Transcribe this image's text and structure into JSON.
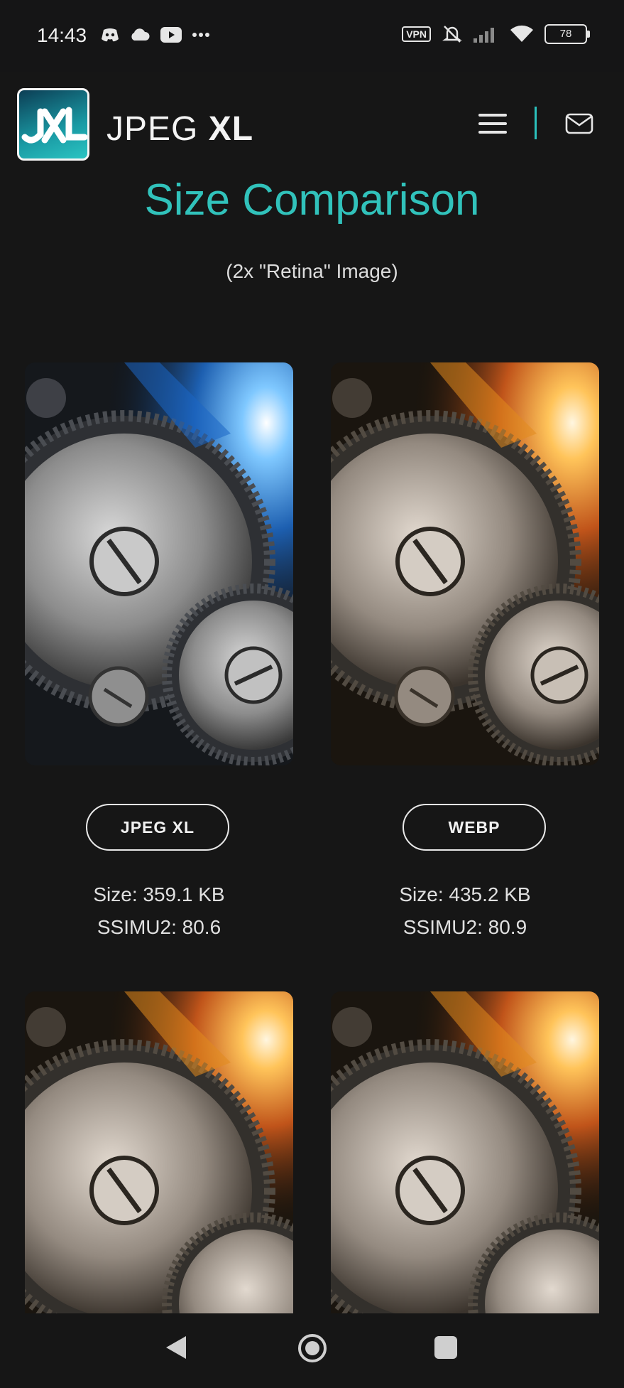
{
  "status_bar": {
    "time": "14:43",
    "left_icons": [
      "discord-icon",
      "cloud-icon",
      "youtube-icon",
      "more-dots-icon"
    ],
    "vpn_label": "VPN",
    "battery": "78"
  },
  "header": {
    "logo_text": "JXL",
    "brand_light": "JPEG ",
    "brand_bold": "XL",
    "menu_icon": "hamburger-menu-icon",
    "mail_icon": "mail-icon",
    "accent": "#31c2bb"
  },
  "page": {
    "title": "Size Comparison",
    "subtitle": "(2x \"Retina\" Image)"
  },
  "comparisons": [
    {
      "format": "JPEG XL",
      "size": "Size: 359.1 KB",
      "ssimu2": "SSIMU2: 80.6",
      "tint": "blue"
    },
    {
      "format": "WEBP",
      "size": "Size: 435.2 KB",
      "ssimu2": "SSIMU2: 80.9",
      "tint": "orange"
    },
    {
      "format": "",
      "size": "",
      "ssimu2": "",
      "tint": "orange"
    },
    {
      "format": "",
      "size": "",
      "ssimu2": "",
      "tint": "orange"
    }
  ],
  "nav_bar": {
    "back_icon": "back-triangle-icon",
    "home_icon": "home-circle-icon",
    "recents_icon": "recents-square-icon"
  }
}
